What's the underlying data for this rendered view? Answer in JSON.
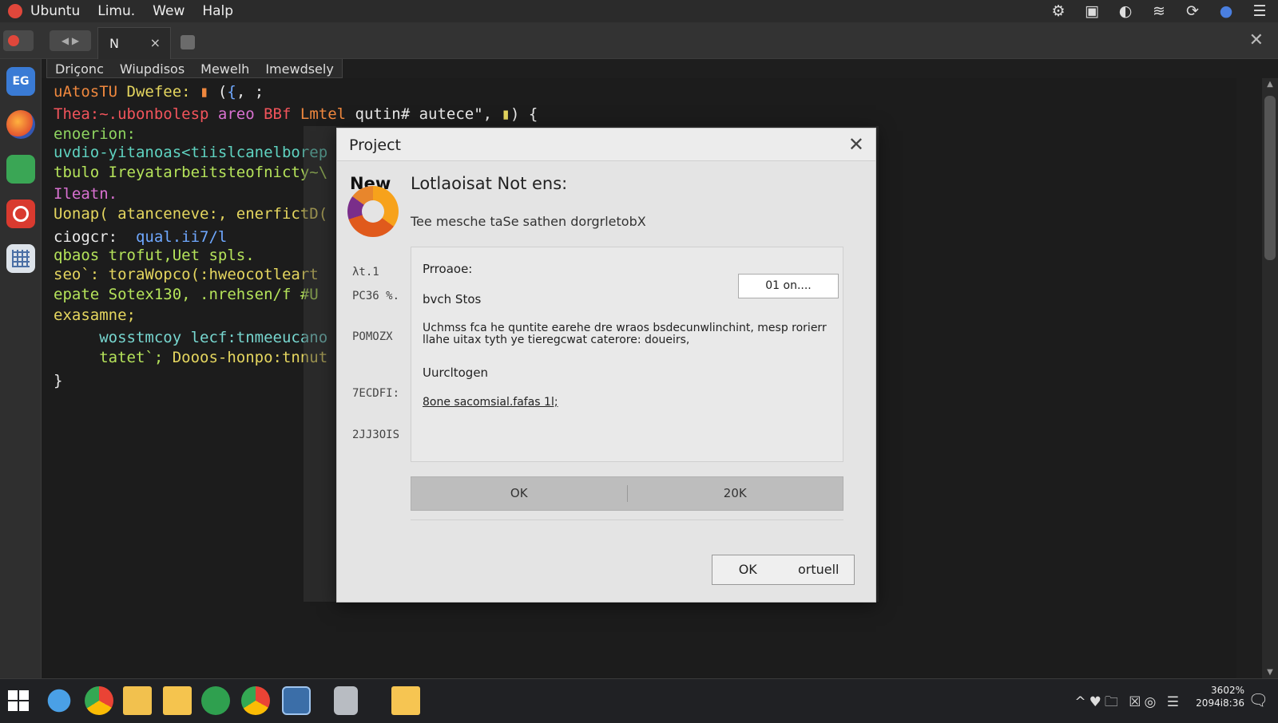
{
  "topbar": {
    "app_name": "Ubuntu",
    "menus": [
      "Limu.",
      "Wew",
      "Halp"
    ],
    "tray_icons": [
      "settings-icon",
      "window-icon",
      "power-icon",
      "wifi-icon",
      "refresh-icon",
      "user-icon",
      "menu-icon"
    ],
    "tray_glyphs": [
      "⚙",
      "▣",
      "◐",
      "≋",
      "⟳",
      "●",
      "☰"
    ]
  },
  "tabstrip": {
    "tab_label": "N",
    "tab_close": "×",
    "close_glyph": "✕",
    "nav_glyphs": "◀ ▶"
  },
  "dock": {
    "first_app_label": "EG"
  },
  "subtabs": [
    "Driçonc",
    "Wiupdisos",
    "Mewelh",
    "Imewdsely"
  ],
  "editor_lines": [
    {
      "parts": [
        [
          "c-orange",
          "uAtosTU "
        ],
        [
          "c-yellow",
          "Dwefee: "
        ],
        [
          "c-orange",
          "▮ "
        ],
        [
          "c-white",
          "("
        ],
        [
          "c-blue",
          "{"
        ],
        [
          "c-white",
          ", ;"
        ]
      ]
    },
    {
      "parts": [
        [
          "c-red",
          "Thea:~.ubonbolesp "
        ],
        [
          "c-pink",
          "areo "
        ],
        [
          "c-red",
          "BBf "
        ],
        [
          "c-orange",
          "Lmtel "
        ],
        [
          "c-white",
          "qutin# autece\", "
        ],
        [
          "c-yellow",
          "▮"
        ],
        [
          "c-white",
          ") {"
        ]
      ]
    },
    {
      "parts": [
        [
          "c-green",
          "enoerion:"
        ]
      ]
    },
    {
      "parts": [
        [
          "c-teal",
          "uvdio-yitanoas<tiislcanelborep"
        ]
      ]
    },
    {
      "parts": [
        [
          "c-lime",
          "tbulo Ireyatarbeitsteofnicty~\\"
        ]
      ]
    },
    {
      "parts": [
        [
          "c-pink",
          "Ileatn."
        ]
      ]
    },
    {
      "parts": [
        [
          "c-yellow",
          "Uonap( atanceneve:, enerfictD("
        ]
      ]
    },
    {
      "parts": [
        [
          "c-white",
          "ciogcr:  "
        ],
        [
          "c-blue",
          "qual.ii7/l"
        ]
      ]
    },
    {
      "parts": [
        [
          "c-lime",
          "qbaos trofut,Uet spls."
        ]
      ]
    },
    {
      "parts": [
        [
          "c-yellow",
          "seo`: toraWopco(:hweocotleart"
        ]
      ]
    },
    {
      "parts": [
        [
          "c-lime",
          "epate Sotex130, .nrehsen/f #U"
        ]
      ]
    },
    {
      "parts": [
        [
          "c-yellow",
          "exasamne;"
        ]
      ]
    },
    {
      "parts": [
        [
          "c-cyan",
          "     wosstmcoy lecf:tnmeeucano"
        ]
      ]
    },
    {
      "parts": [
        [
          "c-lime",
          "     tatet`; "
        ],
        [
          "c-yellow",
          "Dooos-honpo:tnnut"
        ]
      ]
    },
    {
      "parts": [
        [
          "c-white",
          "}"
        ]
      ]
    }
  ],
  "dialog": {
    "title": "Project",
    "close_glyph": "✕",
    "new_label": "New",
    "heading": "Lotlaoisat Not ens:",
    "subtitle": "Tee mesche taSe sathen dorgrletobX",
    "side_labels": [
      "λt.1",
      "PC36 %.",
      "POMOZX",
      "7ECDFI:",
      "2JJ3OIS"
    ],
    "panel": {
      "label1": "Prroaoe:",
      "field_value": "01 on....",
      "label2": "bvch Stos",
      "paragraph": "Uchmss fca he quntite earehe dre wraos bsdecunwlinchint, mesp rorierr llahe uitax tyth ye tieregcwat caterore: doueirs,",
      "label3": "Uurcltogen",
      "link": "8one sacomsial.fafas 1l;"
    },
    "button_bar": [
      "OK",
      "20K"
    ],
    "ok_label": "OK",
    "cancel_label": "ortuell"
  },
  "taskbar": {
    "tray": "^♥🗀 ☒◎ ☰",
    "clock_line1": "3602%",
    "clock_line2": "2094i8:36",
    "notif_glyph": "🗨"
  }
}
